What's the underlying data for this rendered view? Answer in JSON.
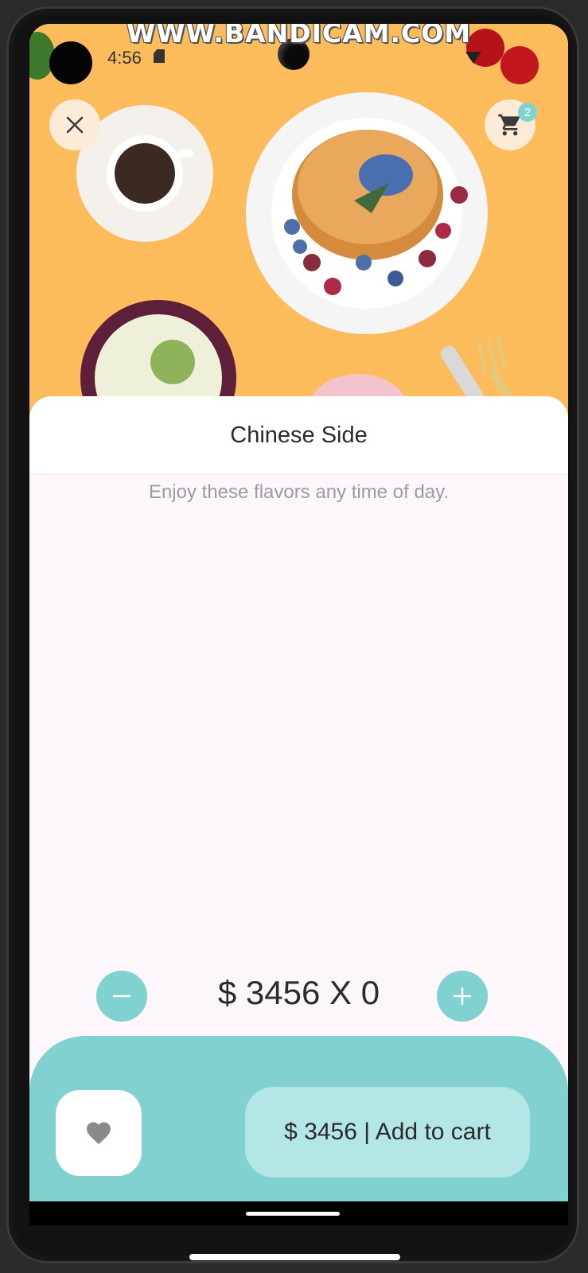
{
  "watermark": "WWW.BANDICAM.COM",
  "status_bar": {
    "time": "4:56",
    "sd_icon": "sd-card-icon",
    "wifi_icon": "wifi-icon"
  },
  "header": {
    "close_icon": "close-icon",
    "cart_icon": "cart-icon",
    "cart_count": "2"
  },
  "product": {
    "title": "Chinese Side",
    "description": "Enjoy these flavors any time of day."
  },
  "quantity": {
    "minus_icon": "minus-icon",
    "plus_icon": "plus-icon",
    "display": "$ 3456 X 0"
  },
  "actions": {
    "favorite_icon": "heart-icon",
    "add_to_cart_label": "$ 3456 | Add to cart"
  },
  "colors": {
    "accent": "#80d1d0",
    "accent_light": "#b3e6e4",
    "hero_background": "#fdbc5c",
    "sheet_background": "#fdf7fb"
  }
}
